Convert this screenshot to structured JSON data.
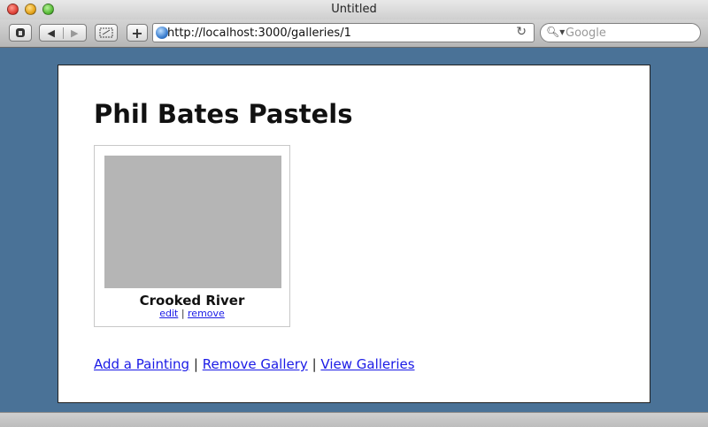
{
  "window": {
    "title": "Untitled"
  },
  "toolbar": {
    "url": "http://localhost:3000/galleries/1",
    "search_placeholder": "Google"
  },
  "page": {
    "heading": "Phil Bates Pastels",
    "paintings": [
      {
        "title": "Crooked River",
        "edit_label": "edit",
        "remove_label": "remove"
      }
    ],
    "separator": "|",
    "links": {
      "add_painting": "Add a Painting",
      "remove_gallery": "Remove Gallery",
      "view_galleries": "View Galleries"
    }
  }
}
